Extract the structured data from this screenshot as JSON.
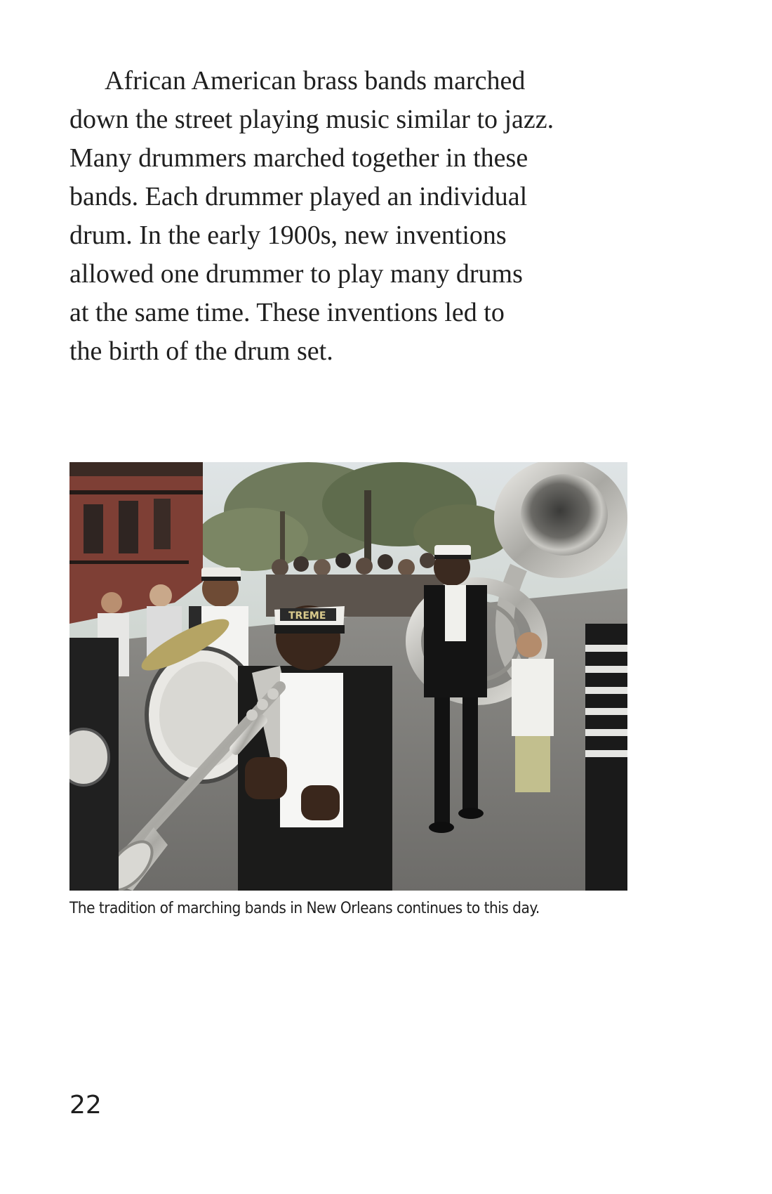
{
  "body_paragraph": {
    "lines": [
      "African American brass bands marched",
      "down the street playing music similar to jazz.",
      "Many drummers marched together in these",
      "bands. Each drummer played an individual",
      "drum. In the early 1900s, new inventions",
      "allowed one drummer to play many drums",
      "at the same time. These inventions led to",
      "the birth of the drum set."
    ]
  },
  "figure": {
    "caption": "The tradition of marching bands in New Orleans continues to this day.",
    "hat_band_text": "TREME"
  },
  "page_number": "22"
}
